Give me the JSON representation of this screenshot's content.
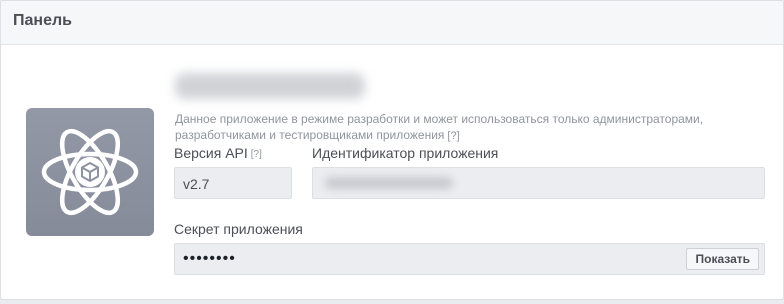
{
  "panel": {
    "title": "Панель"
  },
  "app": {
    "icon": "atom-cube-icon",
    "dev_mode_note": "Данное приложение в режиме разработки и может использоваться только администраторами, разработчиками и тестировщиками приложения",
    "help_mark": "[?]"
  },
  "fields": {
    "api_version": {
      "label": "Версия API",
      "help": "[?]",
      "value": "v2.7"
    },
    "app_id": {
      "label": "Идентификатор приложения"
    },
    "secret": {
      "label": "Секрет приложения",
      "value": "••••••••",
      "show_button": "Показать"
    }
  },
  "colors": {
    "icon_background": "#8e93a2",
    "field_background": "#ebedf0",
    "header_background": "#f6f7f9"
  }
}
